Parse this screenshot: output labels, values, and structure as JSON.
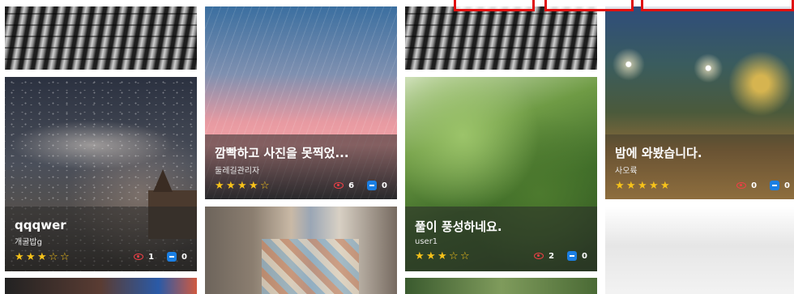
{
  "posts": [
    {
      "title": "qqqwer",
      "author": "개굴밥g",
      "rating": 3,
      "views": "1",
      "comments": "0"
    },
    {
      "title": "깜빡하고 사진을 못찍었...",
      "author": "둘레길관리자",
      "rating": 4,
      "views": "6",
      "comments": "0"
    },
    {
      "title": "풀이 풍성하네요.",
      "author": "user1",
      "rating": 3,
      "views": "2",
      "comments": "0"
    },
    {
      "title": "밤에 와봤습니다.",
      "author": "사오륙",
      "rating": 5,
      "views": "0",
      "comments": "0"
    }
  ],
  "colors": {
    "star": "#f6c21a",
    "view_icon": "#ef3f46",
    "comment_icon": "#1b7fe3",
    "highlight": "#e01010"
  },
  "icons": [
    "star-icon",
    "eye-icon",
    "comment-icon"
  ]
}
